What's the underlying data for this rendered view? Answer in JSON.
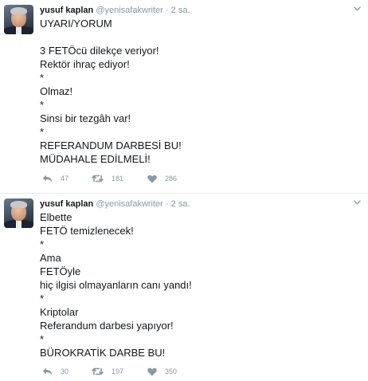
{
  "tweets": [
    {
      "author_name": "yusuf kaplan",
      "handle": "@yenisafakwriter",
      "separator": "·",
      "time": "2 sa.",
      "lines": [
        "UYARI/YORUM",
        "",
        "3 FETÖcü dilekçe veriyor!",
        "Rektör ihraç ediyor!",
        "*",
        "Olmaz!",
        "*",
        "Sinsi bir tezgâh var!",
        "*",
        "REFERANDUM DARBESİ BU!",
        "MÜDAHALE EDİLMELİ!"
      ],
      "replies": "47",
      "retweets": "181",
      "likes": "286"
    },
    {
      "author_name": "yusuf kaplan",
      "handle": "@yenisafakwriter",
      "separator": "·",
      "time": "2 sa.",
      "lines": [
        "Elbette",
        "FETÖ temizlenecek!",
        "*",
        "Ama",
        "FETÖyle",
        "hiç ilgisi olmayanların canı yandı!",
        "*",
        "Kriptolar",
        "Referandum darbesi yapıyor!",
        "*",
        "BÜROKRATİK DARBE BU!"
      ],
      "replies": "30",
      "retweets": "197",
      "likes": "350"
    }
  ],
  "icons": {
    "avatar": "avatar-photo",
    "caret": "chevron-down-icon",
    "reply": "reply-icon",
    "retweet": "retweet-icon",
    "like": "heart-icon"
  },
  "colors": {
    "text": "#14171a",
    "muted": "#8899a6",
    "divider": "#e6ecf0"
  }
}
